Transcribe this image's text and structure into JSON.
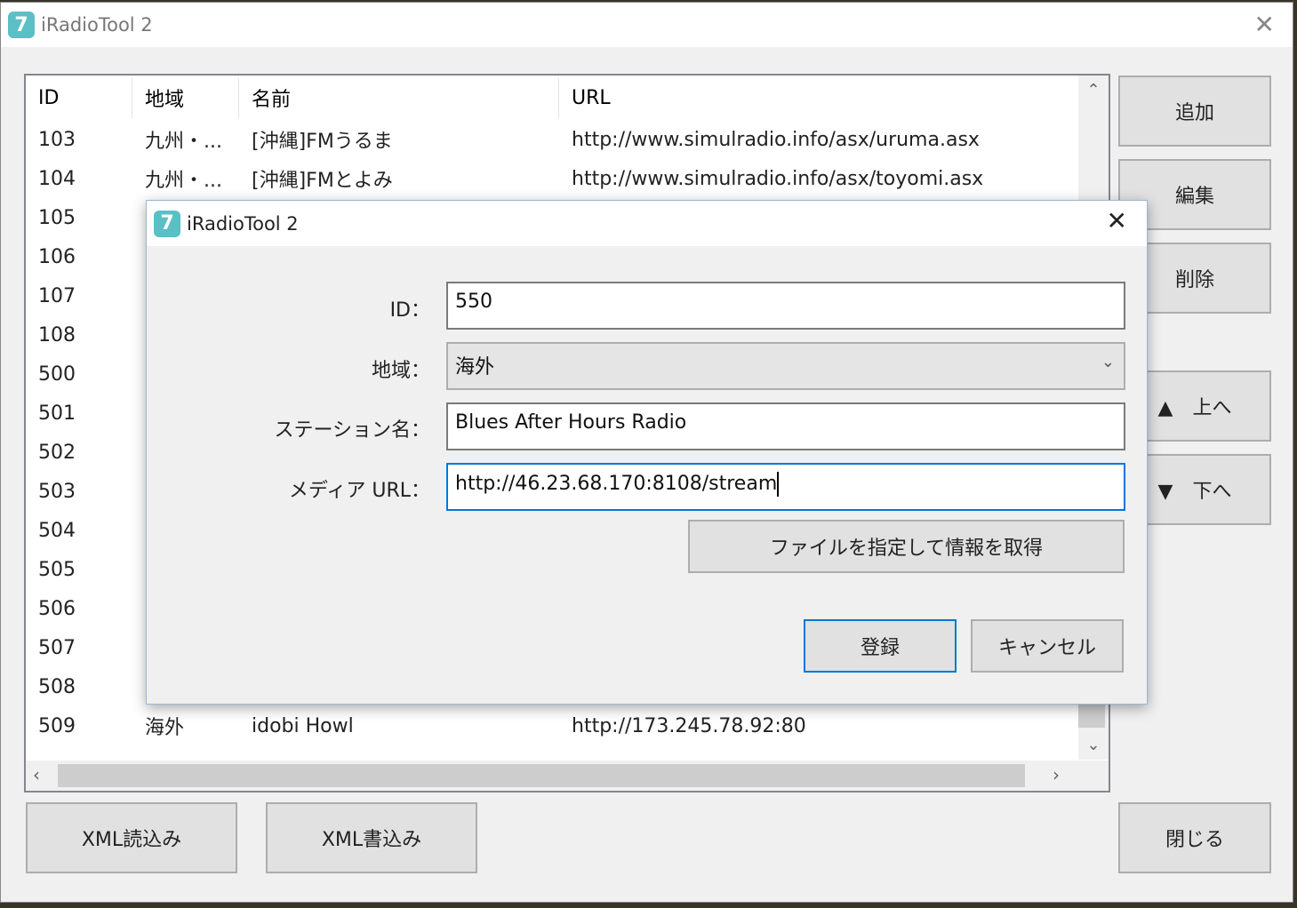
{
  "window": {
    "title": "iRadioTool 2",
    "close": "✕"
  },
  "list": {
    "columns": [
      "ID",
      "地域",
      "名前",
      "URL"
    ],
    "rows": [
      {
        "id": "103",
        "region": "九州・...",
        "name": "[沖縄]FMうるま",
        "url": "http://www.simulradio.info/asx/uruma.asx"
      },
      {
        "id": "104",
        "region": "九州・...",
        "name": "[沖縄]FMとよみ",
        "url": "http://www.simulradio.info/asx/toyomi.asx"
      },
      {
        "id": "105"
      },
      {
        "id": "106"
      },
      {
        "id": "107"
      },
      {
        "id": "108"
      },
      {
        "id": "500"
      },
      {
        "id": "501"
      },
      {
        "id": "502"
      },
      {
        "id": "503"
      },
      {
        "id": "504"
      },
      {
        "id": "505"
      },
      {
        "id": "506"
      },
      {
        "id": "507"
      },
      {
        "id": "508"
      },
      {
        "id": "509",
        "region": "海外",
        "name": "idobi Howl",
        "url": "http://173.245.78.92:80"
      }
    ]
  },
  "buttons": {
    "add": "追加",
    "edit": "編集",
    "delete": "削除",
    "up": "▲　上へ",
    "down": "▼　下へ",
    "xml_read": "XML読込み",
    "xml_write": "XML書込み",
    "close": "閉じる"
  },
  "dialog": {
    "title": "iRadioTool 2",
    "close": "✕",
    "id_label": "ID：",
    "id_value": "550",
    "region_label": "地域：",
    "region_value": "海外",
    "station_label": "ステーション名：",
    "station_value": "Blues After Hours Radio",
    "url_label": "メディア URL：",
    "url_value": "http://46.23.68.170:8108/stream",
    "fetch_button": "ファイルを指定して情報を取得",
    "register_button": "登録",
    "cancel_button": "キャンセル"
  }
}
